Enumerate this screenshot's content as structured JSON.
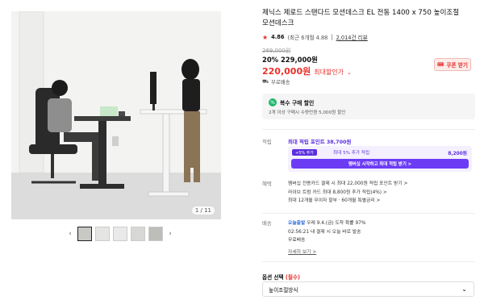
{
  "product": {
    "title_line1": "제닉스 제로드 스탠다드 모션데스크 EL 전동 1400 x 750 높이조절",
    "title_line2": "모션데스크",
    "rating": "4.86",
    "rating_detail": "(최근 6개월 4.88",
    "reviews": "2,014건 리뷰"
  },
  "image": {
    "counter": "1 / 11",
    "thumbnails": [
      "thumb-1",
      "thumb-2",
      "thumb-3",
      "thumb-4",
      "thumb-5"
    ]
  },
  "pricing": {
    "original": "269,000원",
    "discount_line": "20% 229,000원",
    "sale_price": "220,000원",
    "sale_label": "최대할인가",
    "shipping_badge": "무료배송",
    "coupon_button": "쿠폰 받기"
  },
  "promo": {
    "title": "복수 구매 할인",
    "subtitle": "2개 이상 구매시 수량만큼 5,000원 할인"
  },
  "points": {
    "label": "적립",
    "title": "최대 적립 포인트 38,700원",
    "badge": "+5% 추가",
    "desc": "최대 5% 추가 적립",
    "amount": "8,200원",
    "cta": "멤버십 시작하고 최대 적립 받기 >"
  },
  "benefits": {
    "label": "혜택",
    "lines": [
      "멤버십 전용카드 결제 시 최대 22,000원 적립 포인트 받기 >",
      "라이브 트럼 카드 최대 8,800원 추가 적립(4%) >",
      "최대 12개월 무이자 할부 · 60개월 특별금리 >"
    ]
  },
  "delivery": {
    "label": "배송",
    "tag": "오늘출발",
    "line1_rest": "우레 9.4.(금) 도착 확률 97%",
    "line2": "02:56:21 내 결제 시 오늘 바로 발송",
    "line3": "무료배송",
    "more": "자세히 보기 >"
  },
  "options": {
    "label": "옵션 선택",
    "required": "(필수)",
    "selected": "높이조절방식"
  },
  "colors": {
    "accent_red": "#e8312c",
    "point_purple": "#6c3cf5",
    "promo_green": "#1db86a"
  }
}
